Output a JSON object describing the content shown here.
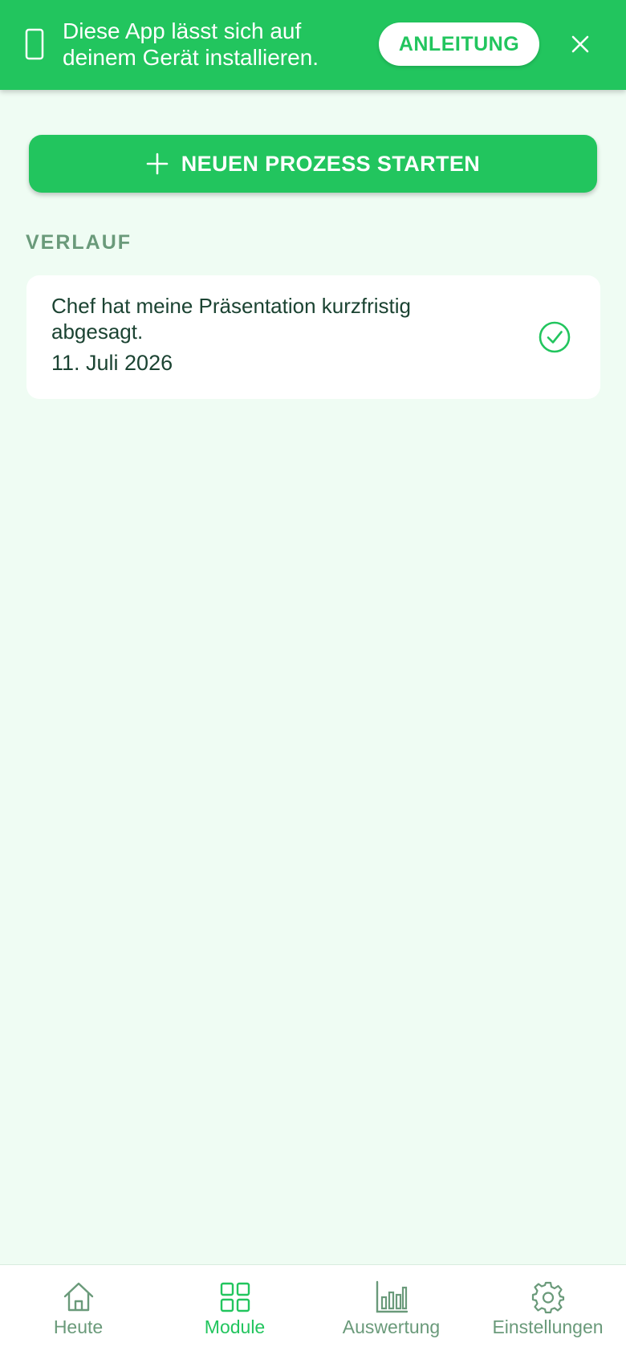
{
  "install_banner": {
    "message": "Diese App lässt sich auf deinem Gerät installieren.",
    "guide_label": "ANLEITUNG",
    "icons": {
      "device": "smartphone-icon",
      "close": "close-icon"
    }
  },
  "main": {
    "start_button_label": "NEUEN PROZESS STARTEN",
    "start_button_icon": "plus-icon",
    "history_heading": "VERLAUF",
    "history": [
      {
        "text": "Chef hat meine Präsentation kurzfristig abgesagt.",
        "date": "11. Juli 2026",
        "status_icon": "check-circle-icon"
      }
    ]
  },
  "bottom_nav": {
    "items": [
      {
        "label": "Heute",
        "icon": "home-icon",
        "active": false
      },
      {
        "label": "Module",
        "icon": "grid-icon",
        "active": true
      },
      {
        "label": "Auswertung",
        "icon": "bar-chart-icon",
        "active": false
      },
      {
        "label": "Einstellungen",
        "icon": "gear-icon",
        "active": false
      }
    ]
  },
  "colors": {
    "accent": "#22c55e",
    "background": "#effcf3",
    "text_dark": "#1b4332",
    "text_muted": "#6a9a7a"
  }
}
